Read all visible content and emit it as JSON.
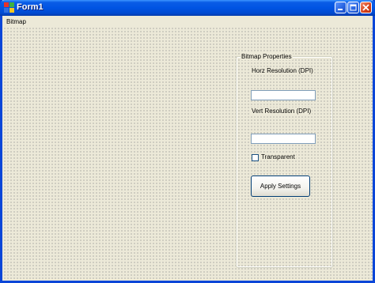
{
  "window": {
    "title": "Form1"
  },
  "menu": {
    "items": [
      {
        "label": "Bitmap"
      }
    ]
  },
  "groupbox": {
    "title": "Bitmap Properties"
  },
  "horz": {
    "label": "Horz Resolution (DPI)",
    "value": ""
  },
  "vert": {
    "label": "Vert Resolution (DPI)",
    "value": ""
  },
  "transparent": {
    "label": "Transparent",
    "checked": false
  },
  "apply": {
    "label": "Apply Settings"
  },
  "colors": {
    "titlebar": "#0054e3",
    "face": "#ece9d8",
    "close": "#d6411a"
  },
  "icons": [
    "app-icon",
    "minimize-icon",
    "maximize-icon",
    "close-icon"
  ]
}
